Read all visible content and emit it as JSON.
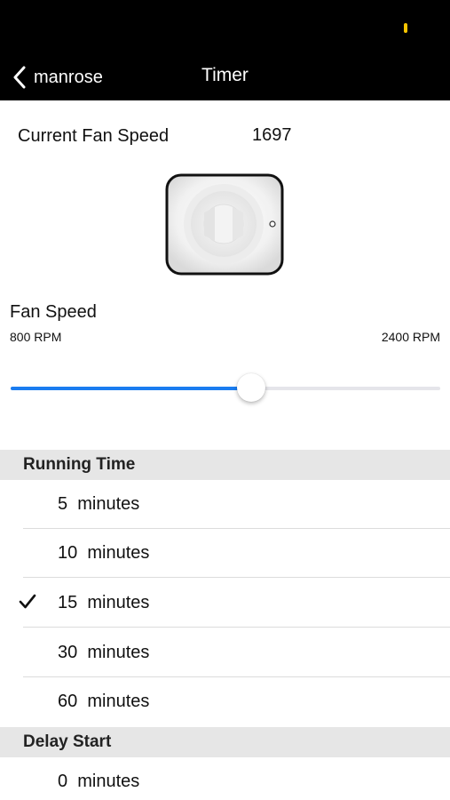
{
  "nav": {
    "back_label": "manrose",
    "title": "Timer"
  },
  "current_fan_speed": {
    "label": "Current Fan Speed",
    "value": "1697"
  },
  "fan_speed": {
    "label": "Fan Speed",
    "min_label": "800 RPM",
    "max_label": "2400 RPM",
    "slider_fraction": 0.56
  },
  "running_time": {
    "header": "Running Time",
    "options": [
      {
        "label": "5  minutes",
        "selected": false
      },
      {
        "label": "10  minutes",
        "selected": false
      },
      {
        "label": "15  minutes",
        "selected": true
      },
      {
        "label": "30  minutes",
        "selected": false
      },
      {
        "label": "60  minutes",
        "selected": false
      }
    ]
  },
  "delay_start": {
    "header": "Delay Start",
    "options": [
      {
        "label": "0  minutes",
        "selected": false
      }
    ]
  },
  "colors": {
    "accent": "#1a7cf0",
    "status_indicator": "#f5c400",
    "nav_background": "#000000"
  },
  "icons": {
    "back": "chevron-left-icon",
    "check": "checkmark-icon",
    "fan": "fan-icon"
  }
}
